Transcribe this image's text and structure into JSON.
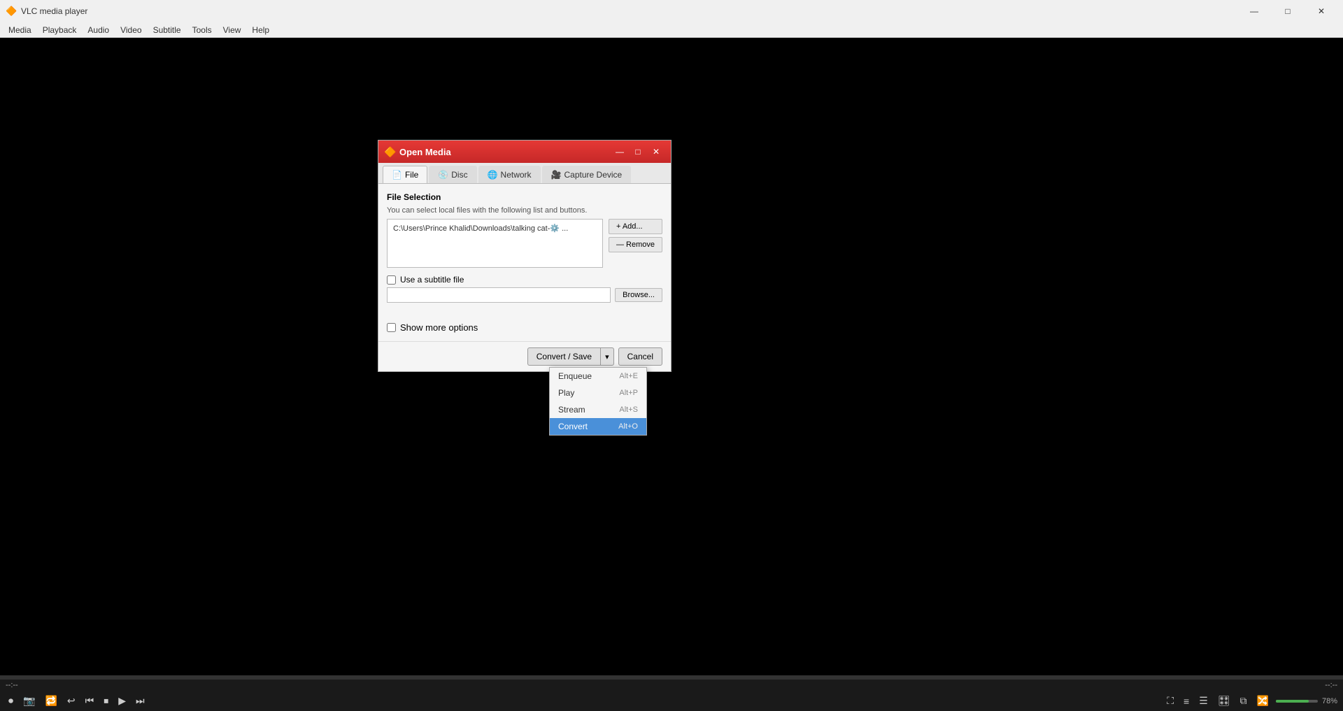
{
  "app": {
    "title": "VLC media player",
    "icon": "🔶"
  },
  "titlebar": {
    "minimize": "—",
    "maximize": "□",
    "close": "✕"
  },
  "menubar": {
    "items": [
      "Media",
      "Playback",
      "Audio",
      "Video",
      "Subtitle",
      "Tools",
      "View",
      "Help"
    ]
  },
  "dialog": {
    "title": "Open Media",
    "icon": "🔶",
    "tabs": [
      {
        "id": "file",
        "label": "File",
        "active": true,
        "icon": "📄"
      },
      {
        "id": "disc",
        "label": "Disc",
        "active": false,
        "icon": "💿"
      },
      {
        "id": "network",
        "label": "Network",
        "active": false,
        "icon": "🌐"
      },
      {
        "id": "capture",
        "label": "Capture Device",
        "active": false,
        "icon": "🎥"
      }
    ],
    "file_selection": {
      "section_title": "File Selection",
      "description": "You can select local files with the following list and buttons.",
      "file_path": "C:\\Users\\Prince Khalid\\Downloads\\talking cat-⚙️ ...",
      "add_button": "+ Add...",
      "remove_button": "— Remove"
    },
    "subtitle": {
      "checkbox_label": "Use a subtitle file",
      "checked": false,
      "placeholder": "",
      "browse_label": "Browse..."
    },
    "show_more": {
      "checked": false,
      "label": "Show more options"
    },
    "footer": {
      "convert_save": "Convert / Save",
      "arrow": "▾",
      "cancel": "Cancel"
    }
  },
  "dropdown": {
    "items": [
      {
        "label": "Enqueue",
        "shortcut": "Alt+E",
        "selected": false
      },
      {
        "label": "Play",
        "shortcut": "Alt+P",
        "selected": false
      },
      {
        "label": "Stream",
        "shortcut": "Alt+S",
        "selected": false
      },
      {
        "label": "Convert",
        "shortcut": "Alt+O",
        "selected": true
      }
    ]
  },
  "player": {
    "time_left": "--:--",
    "time_right": "--:--",
    "volume": "78%"
  }
}
